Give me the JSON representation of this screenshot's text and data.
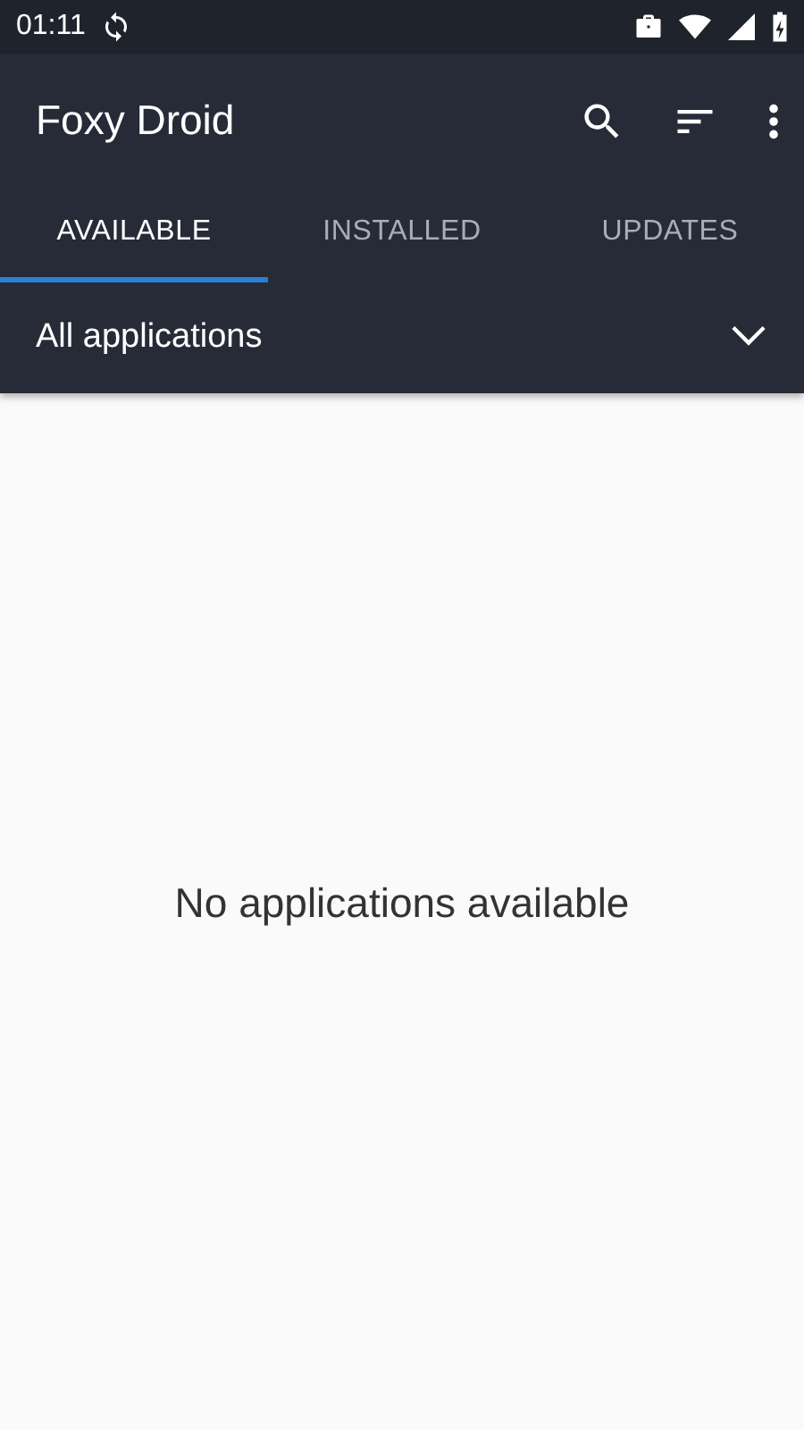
{
  "status_bar": {
    "time": "01:11"
  },
  "toolbar": {
    "title": "Foxy Droid"
  },
  "tabs": [
    {
      "label": "AVAILABLE",
      "selected": true
    },
    {
      "label": "INSTALLED",
      "selected": false
    },
    {
      "label": "UPDATES",
      "selected": false
    }
  ],
  "filter": {
    "value": "All applications"
  },
  "empty_message": "No applications available"
}
